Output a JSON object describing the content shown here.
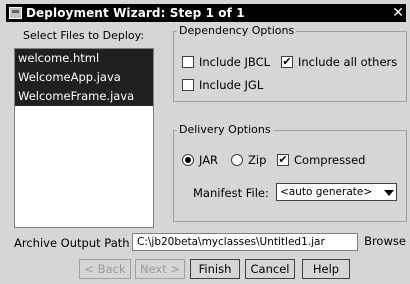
{
  "window": {
    "title": "Deployment Wizard: Step 1 of 1",
    "close_glyph": "✕"
  },
  "files": {
    "label": "Select Files to Deploy:",
    "items": [
      "welcome.html",
      "WelcomeApp.java",
      "WelcomeFrame.java"
    ]
  },
  "dependency": {
    "legend": "Dependency Options",
    "include_jbcl": {
      "label": "Include JBCL",
      "checked": false
    },
    "include_all_others": {
      "label": "Include all others",
      "checked": true
    },
    "include_jgl": {
      "label": "Include JGL",
      "checked": false
    }
  },
  "delivery": {
    "legend": "Delivery Options",
    "jar": {
      "label": "JAR",
      "selected": true
    },
    "zip": {
      "label": "Zip",
      "selected": false
    },
    "compressed": {
      "label": "Compressed",
      "checked": true
    },
    "manifest_label": "Manifest File:",
    "manifest_value": "<auto generate>"
  },
  "archive": {
    "label": "Archive Output Path",
    "value": "C:\\jb20beta\\myclasses\\Untitled1.jar",
    "browse": "Browse"
  },
  "buttons": {
    "back": "< Back",
    "next": "Next >",
    "finish": "Finish",
    "cancel": "Cancel",
    "help": "Help"
  },
  "check_glyph": "✔"
}
